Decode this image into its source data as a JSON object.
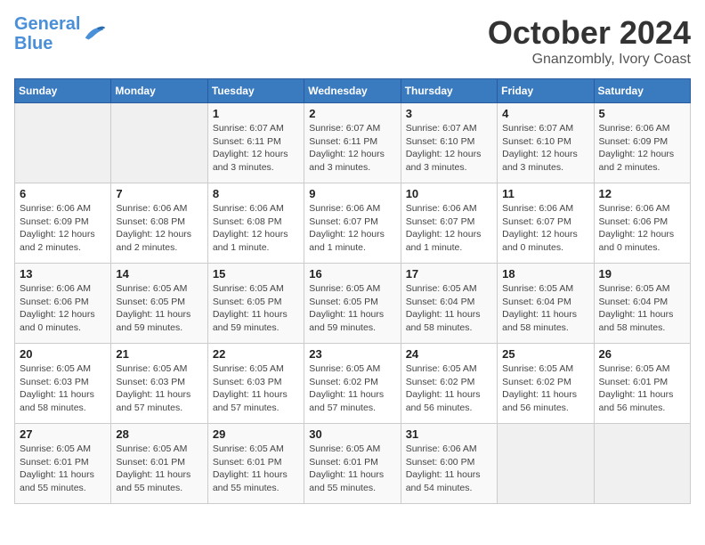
{
  "header": {
    "logo_line1": "General",
    "logo_line2": "Blue",
    "month": "October 2024",
    "location": "Gnanzombly, Ivory Coast"
  },
  "weekdays": [
    "Sunday",
    "Monday",
    "Tuesday",
    "Wednesday",
    "Thursday",
    "Friday",
    "Saturday"
  ],
  "weeks": [
    [
      {
        "day": "",
        "info": ""
      },
      {
        "day": "",
        "info": ""
      },
      {
        "day": "1",
        "info": "Sunrise: 6:07 AM\nSunset: 6:11 PM\nDaylight: 12 hours\nand 3 minutes."
      },
      {
        "day": "2",
        "info": "Sunrise: 6:07 AM\nSunset: 6:11 PM\nDaylight: 12 hours\nand 3 minutes."
      },
      {
        "day": "3",
        "info": "Sunrise: 6:07 AM\nSunset: 6:10 PM\nDaylight: 12 hours\nand 3 minutes."
      },
      {
        "day": "4",
        "info": "Sunrise: 6:07 AM\nSunset: 6:10 PM\nDaylight: 12 hours\nand 3 minutes."
      },
      {
        "day": "5",
        "info": "Sunrise: 6:06 AM\nSunset: 6:09 PM\nDaylight: 12 hours\nand 2 minutes."
      }
    ],
    [
      {
        "day": "6",
        "info": "Sunrise: 6:06 AM\nSunset: 6:09 PM\nDaylight: 12 hours\nand 2 minutes."
      },
      {
        "day": "7",
        "info": "Sunrise: 6:06 AM\nSunset: 6:08 PM\nDaylight: 12 hours\nand 2 minutes."
      },
      {
        "day": "8",
        "info": "Sunrise: 6:06 AM\nSunset: 6:08 PM\nDaylight: 12 hours\nand 1 minute."
      },
      {
        "day": "9",
        "info": "Sunrise: 6:06 AM\nSunset: 6:07 PM\nDaylight: 12 hours\nand 1 minute."
      },
      {
        "day": "10",
        "info": "Sunrise: 6:06 AM\nSunset: 6:07 PM\nDaylight: 12 hours\nand 1 minute."
      },
      {
        "day": "11",
        "info": "Sunrise: 6:06 AM\nSunset: 6:07 PM\nDaylight: 12 hours\nand 0 minutes."
      },
      {
        "day": "12",
        "info": "Sunrise: 6:06 AM\nSunset: 6:06 PM\nDaylight: 12 hours\nand 0 minutes."
      }
    ],
    [
      {
        "day": "13",
        "info": "Sunrise: 6:06 AM\nSunset: 6:06 PM\nDaylight: 12 hours\nand 0 minutes."
      },
      {
        "day": "14",
        "info": "Sunrise: 6:05 AM\nSunset: 6:05 PM\nDaylight: 11 hours\nand 59 minutes."
      },
      {
        "day": "15",
        "info": "Sunrise: 6:05 AM\nSunset: 6:05 PM\nDaylight: 11 hours\nand 59 minutes."
      },
      {
        "day": "16",
        "info": "Sunrise: 6:05 AM\nSunset: 6:05 PM\nDaylight: 11 hours\nand 59 minutes."
      },
      {
        "day": "17",
        "info": "Sunrise: 6:05 AM\nSunset: 6:04 PM\nDaylight: 11 hours\nand 58 minutes."
      },
      {
        "day": "18",
        "info": "Sunrise: 6:05 AM\nSunset: 6:04 PM\nDaylight: 11 hours\nand 58 minutes."
      },
      {
        "day": "19",
        "info": "Sunrise: 6:05 AM\nSunset: 6:04 PM\nDaylight: 11 hours\nand 58 minutes."
      }
    ],
    [
      {
        "day": "20",
        "info": "Sunrise: 6:05 AM\nSunset: 6:03 PM\nDaylight: 11 hours\nand 58 minutes."
      },
      {
        "day": "21",
        "info": "Sunrise: 6:05 AM\nSunset: 6:03 PM\nDaylight: 11 hours\nand 57 minutes."
      },
      {
        "day": "22",
        "info": "Sunrise: 6:05 AM\nSunset: 6:03 PM\nDaylight: 11 hours\nand 57 minutes."
      },
      {
        "day": "23",
        "info": "Sunrise: 6:05 AM\nSunset: 6:02 PM\nDaylight: 11 hours\nand 57 minutes."
      },
      {
        "day": "24",
        "info": "Sunrise: 6:05 AM\nSunset: 6:02 PM\nDaylight: 11 hours\nand 56 minutes."
      },
      {
        "day": "25",
        "info": "Sunrise: 6:05 AM\nSunset: 6:02 PM\nDaylight: 11 hours\nand 56 minutes."
      },
      {
        "day": "26",
        "info": "Sunrise: 6:05 AM\nSunset: 6:01 PM\nDaylight: 11 hours\nand 56 minutes."
      }
    ],
    [
      {
        "day": "27",
        "info": "Sunrise: 6:05 AM\nSunset: 6:01 PM\nDaylight: 11 hours\nand 55 minutes."
      },
      {
        "day": "28",
        "info": "Sunrise: 6:05 AM\nSunset: 6:01 PM\nDaylight: 11 hours\nand 55 minutes."
      },
      {
        "day": "29",
        "info": "Sunrise: 6:05 AM\nSunset: 6:01 PM\nDaylight: 11 hours\nand 55 minutes."
      },
      {
        "day": "30",
        "info": "Sunrise: 6:05 AM\nSunset: 6:01 PM\nDaylight: 11 hours\nand 55 minutes."
      },
      {
        "day": "31",
        "info": "Sunrise: 6:06 AM\nSunset: 6:00 PM\nDaylight: 11 hours\nand 54 minutes."
      },
      {
        "day": "",
        "info": ""
      },
      {
        "day": "",
        "info": ""
      }
    ]
  ]
}
